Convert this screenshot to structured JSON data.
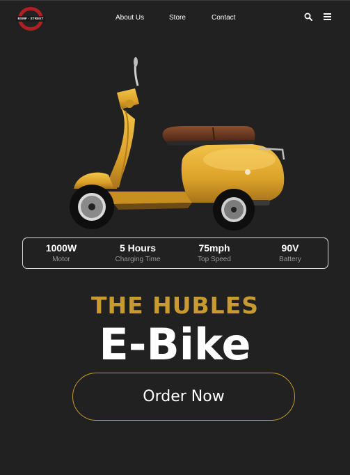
{
  "brand": {
    "logo_text": "BSMF · STREET"
  },
  "nav": {
    "links": [
      "About Us",
      "Store",
      "Contact"
    ],
    "icons": [
      "search-icon",
      "menu-icon"
    ]
  },
  "specs": [
    {
      "value": "1000W",
      "label": "Motor"
    },
    {
      "value": "5 Hours",
      "label": "Charging Time"
    },
    {
      "value": "75mph",
      "label": "Top Speed"
    },
    {
      "value": "90V",
      "label": "Battery"
    }
  ],
  "hero": {
    "subtitle": "THE HUBLES",
    "title": "E-Bike",
    "cta_label": "Order Now"
  },
  "colors": {
    "background": "#212121",
    "accent_gold": "#c99a30",
    "logo_red": "#b01f24",
    "scooter_body": "#e0a82c",
    "seat_brown": "#6b3a22"
  }
}
